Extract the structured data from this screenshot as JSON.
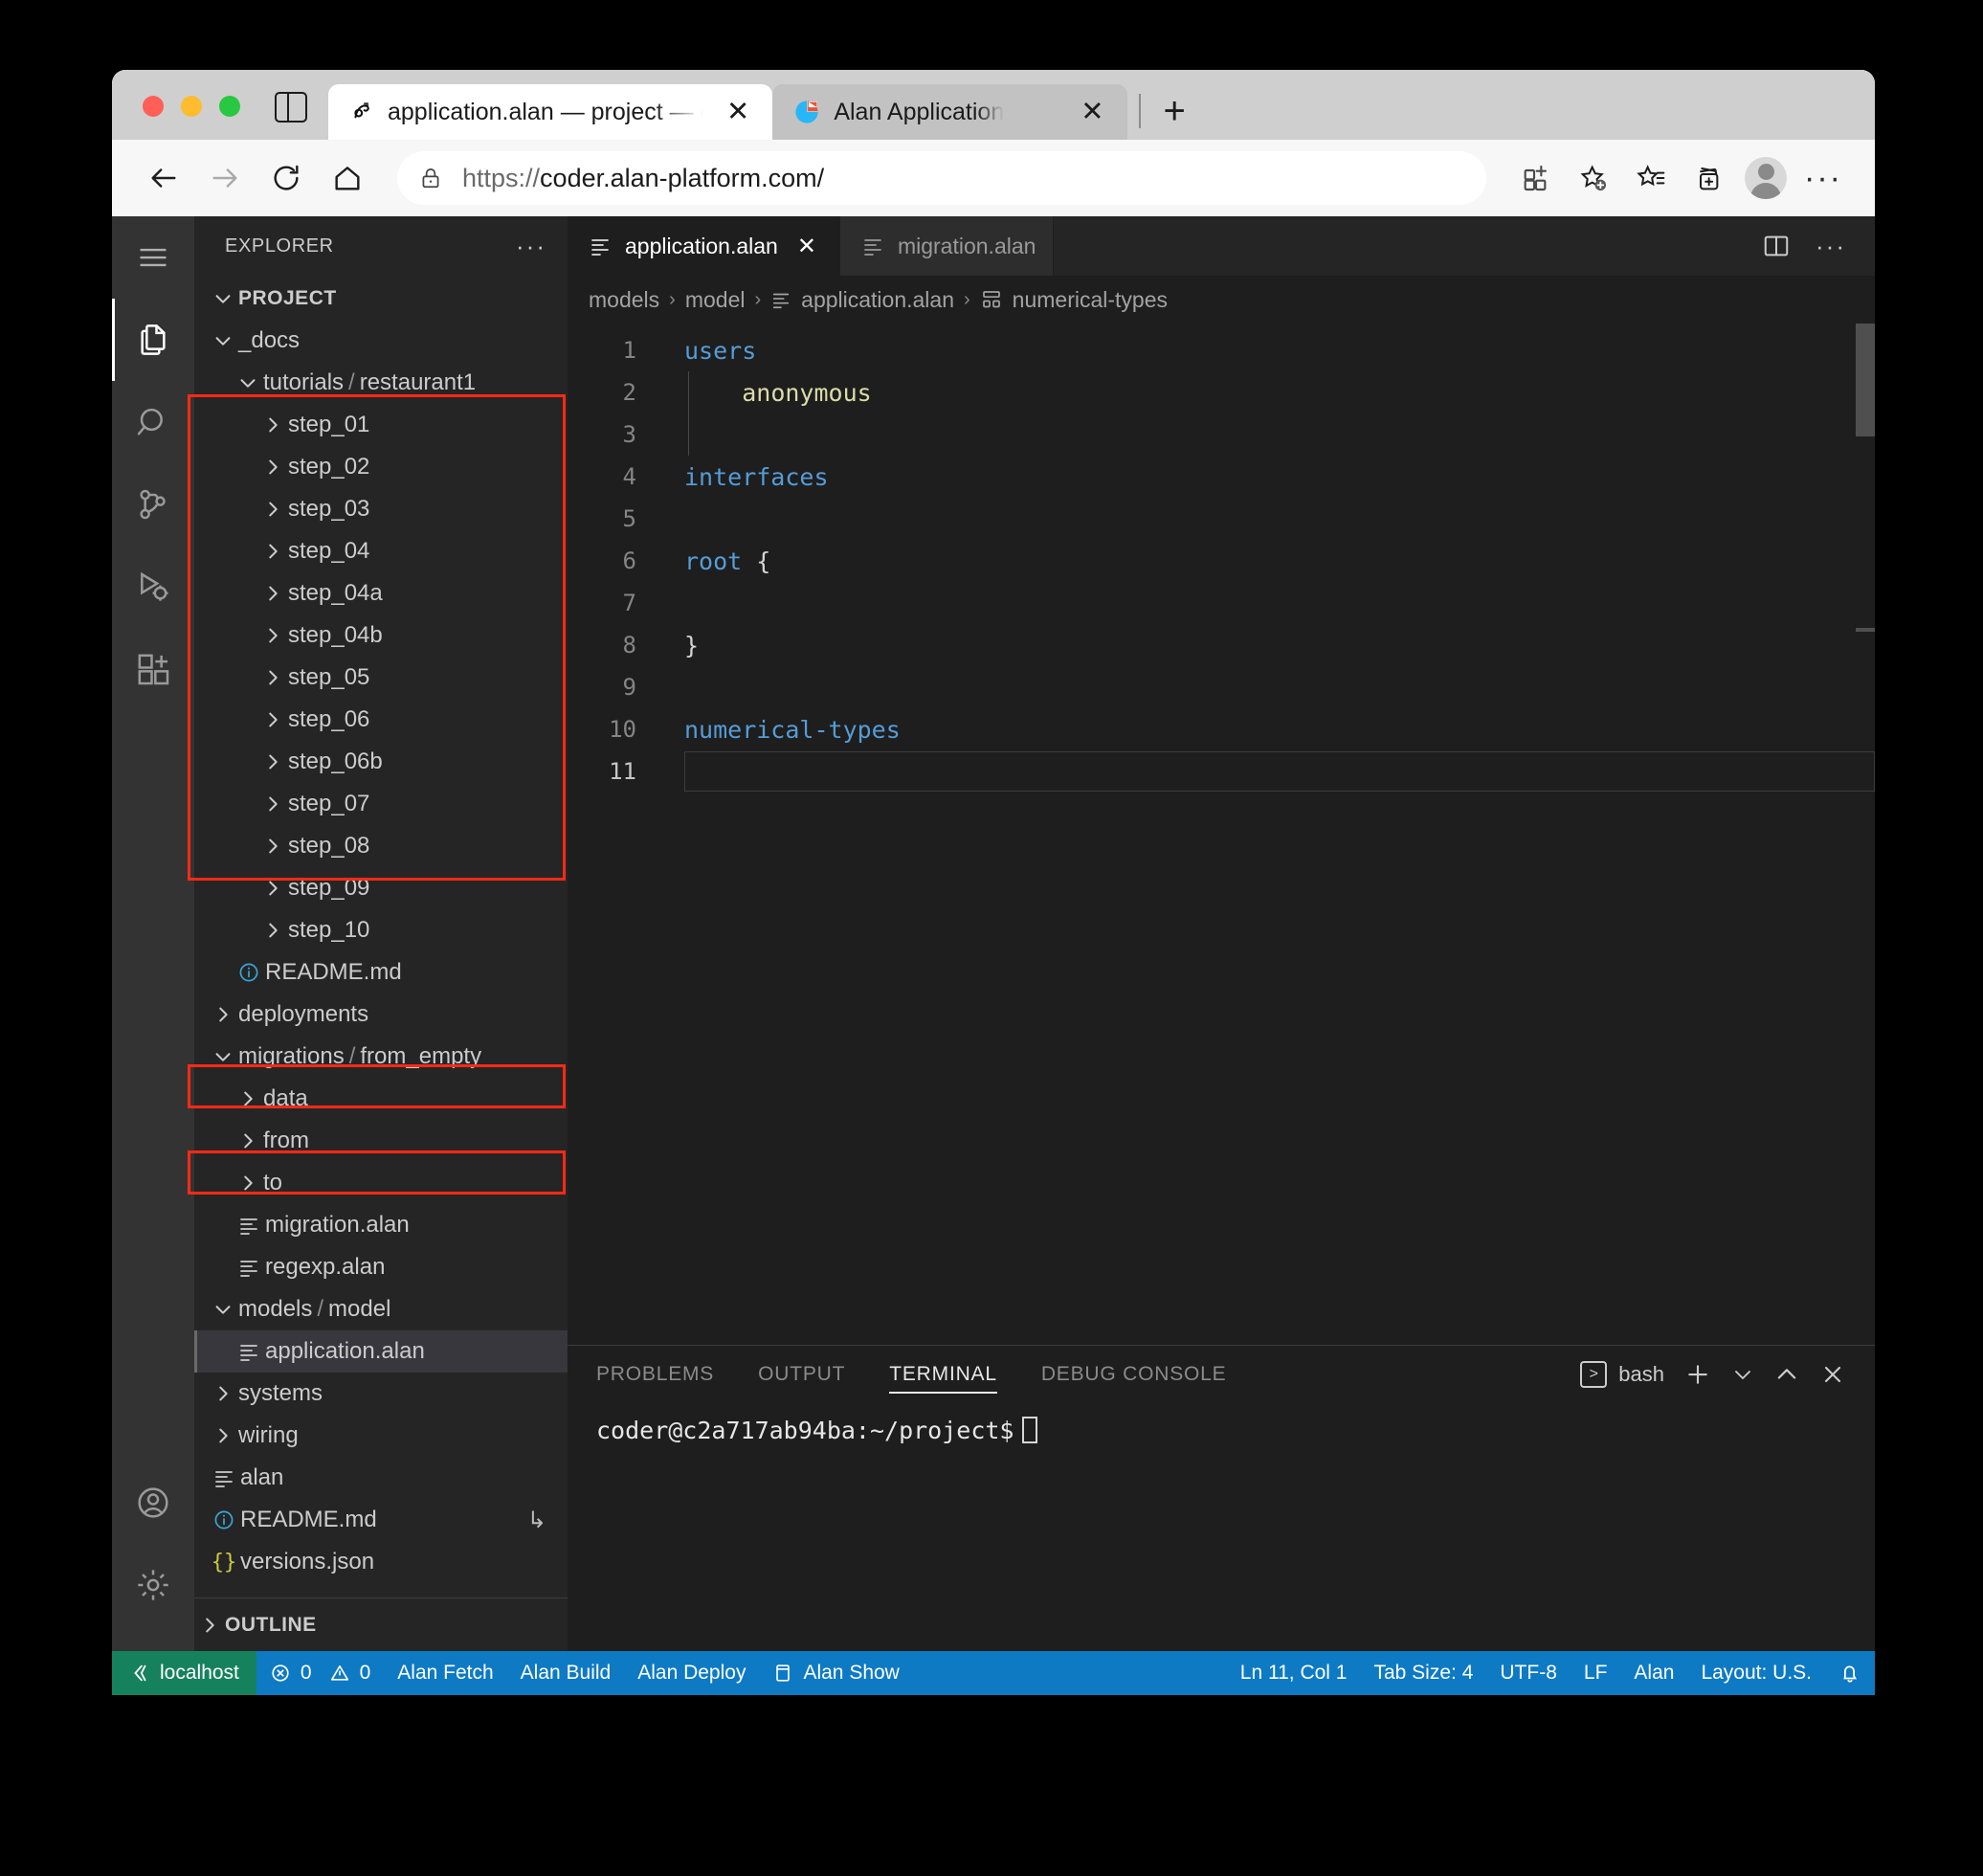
{
  "browser": {
    "tabs": [
      {
        "title": "application.alan — project — co",
        "icon": "alan-logo-icon",
        "active": true,
        "close_label": "✕"
      },
      {
        "title": "Alan Application",
        "icon": "alan-pie-icon",
        "active": false,
        "close_label": "✕"
      }
    ],
    "new_tab_label": "+",
    "url": "https://coder.alan-platform.com/",
    "url_scheme": "https://",
    "url_rest": "coder.alan-platform.com/",
    "nav": {
      "back": "back-arrow",
      "forward": "forward-arrow",
      "reload": "reload",
      "home": "home"
    },
    "toolbar_right": [
      "split-screen-add-icon",
      "add-favorite-icon",
      "favorites-icon",
      "collections-icon",
      "profile-avatar",
      "settings-more-icon"
    ]
  },
  "vscode": {
    "activitybar": [
      {
        "name": "menu-icon",
        "label": "Menu"
      },
      {
        "name": "explorer-icon",
        "label": "Explorer",
        "active": true
      },
      {
        "name": "search-icon",
        "label": "Search"
      },
      {
        "name": "source-control-icon",
        "label": "Source Control"
      },
      {
        "name": "run-debug-icon",
        "label": "Run and Debug"
      },
      {
        "name": "extensions-icon",
        "label": "Extensions"
      },
      {
        "name": "accounts-icon",
        "label": "Accounts"
      },
      {
        "name": "settings-gear-icon",
        "label": "Manage"
      }
    ],
    "sidebar": {
      "title": "EXPLORER",
      "more_label": "···",
      "root": "PROJECT",
      "outline": "OUTLINE",
      "tree": [
        {
          "label": "_docs",
          "indent": 1,
          "type": "folder",
          "open": true
        },
        {
          "label": "tutorials",
          "label2": "restaurant1",
          "indent": 2,
          "type": "folder",
          "open": true
        },
        {
          "label": "step_01",
          "indent": 3,
          "type": "folder",
          "open": false
        },
        {
          "label": "step_02",
          "indent": 3,
          "type": "folder",
          "open": false
        },
        {
          "label": "step_03",
          "indent": 3,
          "type": "folder",
          "open": false
        },
        {
          "label": "step_04",
          "indent": 3,
          "type": "folder",
          "open": false
        },
        {
          "label": "step_04a",
          "indent": 3,
          "type": "folder",
          "open": false
        },
        {
          "label": "step_04b",
          "indent": 3,
          "type": "folder",
          "open": false
        },
        {
          "label": "step_05",
          "indent": 3,
          "type": "folder",
          "open": false
        },
        {
          "label": "step_06",
          "indent": 3,
          "type": "folder",
          "open": false
        },
        {
          "label": "step_06b",
          "indent": 3,
          "type": "folder",
          "open": false
        },
        {
          "label": "step_07",
          "indent": 3,
          "type": "folder",
          "open": false
        },
        {
          "label": "step_08",
          "indent": 3,
          "type": "folder",
          "open": false
        },
        {
          "label": "step_09",
          "indent": 3,
          "type": "folder",
          "open": false
        },
        {
          "label": "step_10",
          "indent": 3,
          "type": "folder",
          "open": false
        },
        {
          "label": "README.md",
          "indent": 2,
          "type": "info"
        },
        {
          "label": "deployments",
          "indent": 1,
          "type": "folder",
          "open": false
        },
        {
          "label": "migrations",
          "label2": "from_empty",
          "indent": 1,
          "type": "folder",
          "open": true
        },
        {
          "label": "data",
          "indent": 2,
          "type": "folder",
          "open": false
        },
        {
          "label": "from",
          "indent": 2,
          "type": "folder",
          "open": false
        },
        {
          "label": "to",
          "indent": 2,
          "type": "folder",
          "open": false
        },
        {
          "label": "migration.alan",
          "indent": 2,
          "type": "alan"
        },
        {
          "label": "regexp.alan",
          "indent": 2,
          "type": "alan"
        },
        {
          "label": "models",
          "label2": "model",
          "indent": 1,
          "type": "folder",
          "open": true
        },
        {
          "label": "application.alan",
          "indent": 2,
          "type": "alan",
          "selected": true
        },
        {
          "label": "systems",
          "indent": 1,
          "type": "folder",
          "open": false
        },
        {
          "label": "wiring",
          "indent": 1,
          "type": "folder",
          "open": false
        },
        {
          "label": "alan",
          "indent": 1,
          "type": "alan"
        },
        {
          "label": "README.md",
          "indent": 1,
          "type": "info",
          "trailing": "↳"
        },
        {
          "label": "versions.json",
          "indent": 1,
          "type": "json"
        }
      ]
    },
    "editor": {
      "tabs": [
        {
          "label": "application.alan",
          "active": true,
          "close": "✕"
        },
        {
          "label": "migration.alan",
          "active": false
        }
      ],
      "actions": [
        "split-editor-icon",
        "editor-more-icon"
      ],
      "breadcrumb": [
        {
          "label": "models",
          "icon": ""
        },
        {
          "label": "model",
          "icon": ""
        },
        {
          "label": "application.alan",
          "icon": "alan-file-icon"
        },
        {
          "label": "numerical-types",
          "icon": "symbol-structure-icon"
        }
      ],
      "breadcrumb_sep": "›",
      "lines": [
        {
          "n": "1",
          "text": "users",
          "kind": "kw"
        },
        {
          "n": "2",
          "text": "    anonymous",
          "kind": "val",
          "indent": 4
        },
        {
          "n": "3",
          "text": "",
          "kind": "plain"
        },
        {
          "n": "4",
          "text": "interfaces",
          "kind": "kw"
        },
        {
          "n": "5",
          "text": "",
          "kind": "plain"
        },
        {
          "n": "6",
          "text": "root {",
          "kind": "kw-brace"
        },
        {
          "n": "7",
          "text": "",
          "kind": "plain"
        },
        {
          "n": "8",
          "text": "}",
          "kind": "plain"
        },
        {
          "n": "9",
          "text": "",
          "kind": "plain"
        },
        {
          "n": "10",
          "text": "numerical-types",
          "kind": "kw"
        },
        {
          "n": "11",
          "text": "",
          "kind": "plain",
          "current": true
        }
      ]
    },
    "panel": {
      "tabs": [
        {
          "label": "PROBLEMS",
          "active": false
        },
        {
          "label": "OUTPUT",
          "active": false
        },
        {
          "label": "TERMINAL",
          "active": true
        },
        {
          "label": "DEBUG CONSOLE",
          "active": false
        }
      ],
      "shell": "bash",
      "actions": [
        "new-terminal-icon",
        "terminal-dropdown-icon",
        "maximize-panel-icon",
        "close-panel-icon"
      ],
      "prompt": "coder@c2a717ab94ba:~/project$"
    },
    "statusbar": {
      "remote": "localhost",
      "errors": "0",
      "warnings": "0",
      "items": [
        {
          "label": "Alan Fetch"
        },
        {
          "label": "Alan Build"
        },
        {
          "label": "Alan Deploy"
        },
        {
          "label": "Alan Show",
          "icon": "preview-icon"
        }
      ],
      "right": [
        {
          "label": "Ln 11, Col 1"
        },
        {
          "label": "Tab Size: 4"
        },
        {
          "label": "UTF-8"
        },
        {
          "label": "LF"
        },
        {
          "label": "Alan"
        },
        {
          "label": "Layout: U.S."
        },
        {
          "label": "",
          "icon": "bell-icon"
        }
      ]
    }
  }
}
